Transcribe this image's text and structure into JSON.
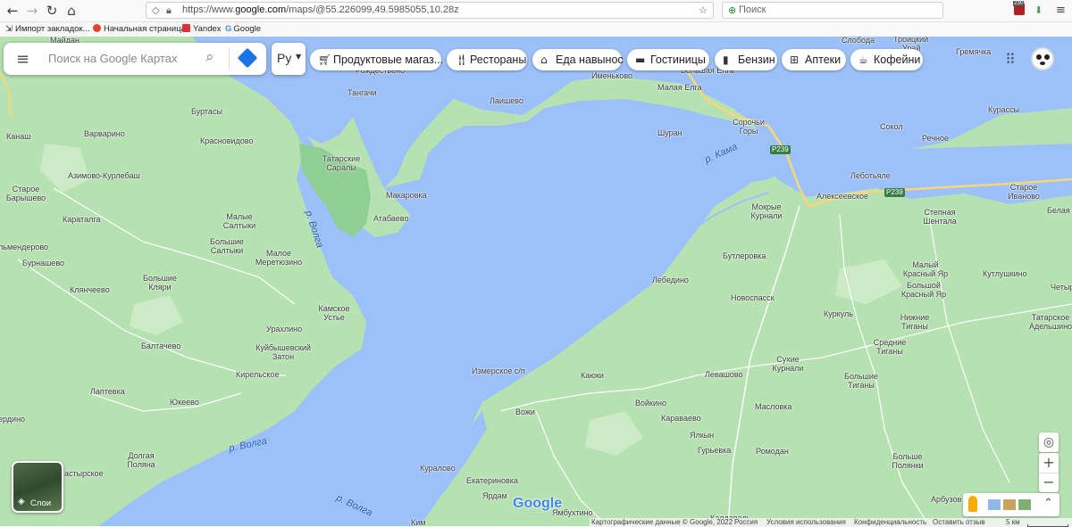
{
  "browser": {
    "url_prefix": "https://www.",
    "url_domain": "google.com",
    "url_rest": "/maps/@55.226099,49.5985055,10.28z",
    "search_placeholder": "Поиск",
    "ext_badge": "230",
    "bookmarks": [
      "Импорт закладок...",
      "Начальная страница",
      "Yandex",
      "Google"
    ]
  },
  "maps": {
    "search_placeholder": "Поиск на Google Картах",
    "lang": "Ру",
    "chips": [
      "Продуктовые магаз...",
      "Рестораны",
      "Еда навынос",
      "Гостиницы",
      "Бензин",
      "Аптеки",
      "Кофейни"
    ],
    "layers_label": "Слои",
    "logo": "Google",
    "footer": {
      "copyright": "Картографические данные © Google, 2022",
      "country": "Россия",
      "terms": "Условия использования",
      "privacy": "Конфиденциальность",
      "feedback": "Оставить отзыв",
      "scale": "5 км"
    }
  },
  "rivers": [
    "р. Волга",
    "р. Кама",
    "р. Волга",
    "р. Волга"
  ],
  "roads": [
    "P239",
    "P239"
  ],
  "places": [
    "Майдан",
    "Рождествено",
    "Именьково",
    "Большая Елга",
    "Слобода",
    "Троицкий",
    "Урай",
    "Гремячка",
    "Тангачи",
    "Лаишево",
    "Малая Елга",
    "Буртасы",
    "Сорочьи Горы",
    "Шуран",
    "Сокол",
    "Курассы",
    "Канаш",
    "Варварино",
    "Красновидово",
    "Татарские Саралы",
    "Речное",
    "Старое Барышево",
    "Азимово-Курлебаш",
    "Макаровка",
    "Атабаево",
    "Алексеевское",
    "Мокрые Курнали",
    "Леботьяле",
    "Старое Иваново",
    "Караталга",
    "Малые Салтыки",
    "Большие Салтыки",
    "Степная Шентала",
    "Белая",
    "льмендерово",
    "Малое Меретюзино",
    "Бурнашево",
    "Бутлеровка",
    "Малый Красный Яр",
    "Большой Красный Яр",
    "Кутлушкино",
    "Четыр",
    "Клянчеево",
    "Большие Кляри",
    "Лебедино",
    "Новоспасск",
    "Камское Устье",
    "Куркуль",
    "Нижние Тиганы",
    "Татарское Адельшино",
    "Урахлино",
    "Балтачево",
    "Куйбышевский Затон",
    "Средние Тиганы",
    "Кирельское",
    "Сухие Курнали",
    "Измерское с/п",
    "Каюки",
    "Левашово",
    "Большие Тиганы",
    "Лаптевка",
    "Юкеево",
    "Войкино",
    "Масловка",
    "ердино",
    "Вожи",
    "Караваево",
    "Ялкын",
    "Долгая Поляна",
    "Гурьевка",
    "Ромодан",
    "Больше Полянки",
    "астырское",
    "Куралово",
    "Екатериновка",
    "Ярдам",
    "Ямбухтино",
    "Арбузов",
    "Ким",
    "Калдаваль"
  ]
}
